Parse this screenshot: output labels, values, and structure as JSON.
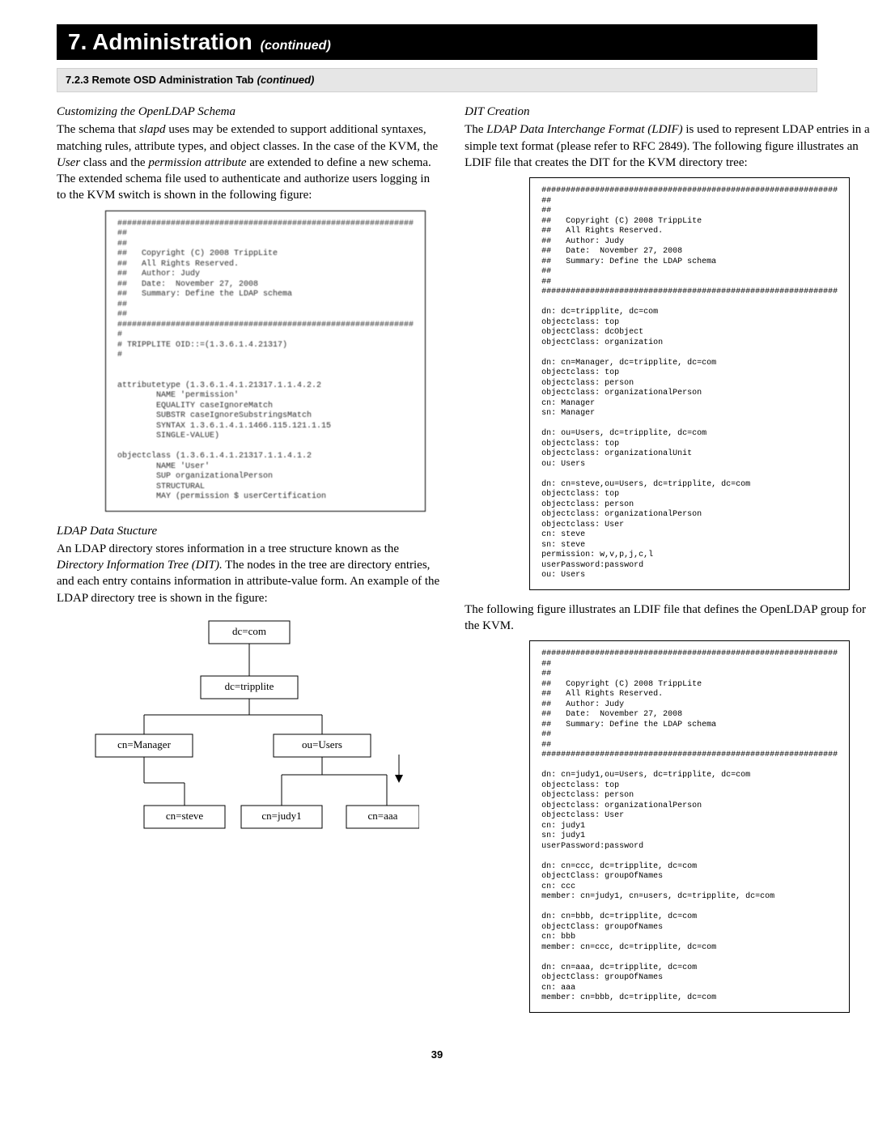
{
  "chapter": {
    "num": "7.",
    "title": "Administration",
    "continued": "(continued)"
  },
  "subhead": {
    "number": "7.2.3",
    "title": "Remote OSD Administration Tab",
    "continued": "(continued)"
  },
  "left": {
    "sec1_title": "Customizing the OpenLDAP Schema",
    "sec1_para": "The schema that slapd uses may be extended to support additional syntaxes, matching rules, attribute types, and object classes. In the case of the KVM, the User class and the permission attribute are extended to define a new schema. The extended schema file used to authenticate and authorize users logging in to the KVM switch is shown in the following figure:",
    "fig1": "#############################################################\n##\n##\n##   Copyright (C) 2008 TrippLite\n##   All Rights Reserved.\n##   Author: Judy\n##   Date:  November 27, 2008\n##   Summary: Define the LDAP schema\n##\n##\n#############################################################\n#\n# TRIPPLITE OID::=(1.3.6.1.4.21317)\n#\n\n\nattributetype (1.3.6.1.4.1.21317.1.1.4.2.2\n        NAME 'permission'\n        EQUALITY caseIgnoreMatch\n        SUBSTR caseIgnoreSubstringsMatch\n        SYNTAX 1.3.6.1.4.1.1466.115.121.1.15\n        SINGLE-VALUE)\n\nobjectclass (1.3.6.1.4.1.21317.1.1.4.1.2\n        NAME 'User'\n        SUP organizationalPerson\n        STRUCTURAL\n        MAY (permission $ userCertification",
    "sec2_title": "LDAP Data Stucture",
    "sec2_para": "An LDAP directory stores information in a tree structure known as the Directory Information Tree (DIT). The nodes in the tree are directory entries, and each entry contains information in attribute-value form. An example of the LDAP directory tree is shown in the figure:",
    "tree": {
      "root": "dc=com",
      "lvl2": "dc=tripplite",
      "lvl3a": "cn=Manager",
      "lvl3b": "ou=Users",
      "lvl4a": "cn=steve",
      "lvl4b": "cn=judy1",
      "lvl4c": "cn=aaa"
    }
  },
  "right": {
    "sec1_title": "DIT Creation",
    "sec1_para": "The LDAP Data Interchange Format (LDIF) is used to represent LDAP entries in a simple text format (please refer to RFC 2849). The following figure illustrates an LDIF file that creates the DIT for the KVM directory tree:",
    "fig1": "#############################################################\n##\n##\n##   Copyright (C) 2008 TrippLite\n##   All Rights Reserved.\n##   Author: Judy\n##   Date:  November 27, 2008\n##   Summary: Define the LDAP schema\n##\n##\n#############################################################\n\ndn: dc=tripplite, dc=com\nobjectclass: top\nobjectClass: dcObject\nobjectClass: organization\n\ndn: cn=Manager, dc=tripplite, dc=com\nobjectclass: top\nobjectclass: person\nobjectclass: organizationalPerson\ncn: Manager\nsn: Manager\n\ndn: ou=Users, dc=tripplite, dc=com\nobjectclass: top\nobjectclass: organizationalUnit\nou: Users\n\ndn: cn=steve,ou=Users, dc=tripplite, dc=com\nobjectclass: top\nobjectclass: person\nobjectclass: organizationalPerson\nobjectclass: User\ncn: steve\nsn: steve\npermission: w,v,p,j,c,l\nuserPassword:password\nou: Users",
    "sec2_para": "The following figure illustrates an LDIF file that defines the OpenLDAP group for the KVM.",
    "fig2": "#############################################################\n##\n##\n##   Copyright (C) 2008 TrippLite\n##   All Rights Reserved.\n##   Author: Judy\n##   Date:  November 27, 2008\n##   Summary: Define the LDAP schema\n##\n##\n#############################################################\n\ndn: cn=judy1,ou=Users, dc=tripplite, dc=com\nobjectclass: top\nobjectclass: person\nobjectclass: organizationalPerson\nobjectclass: User\ncn: judy1\nsn: judy1\nuserPassword:password\n\ndn: cn=ccc, dc=tripplite, dc=com\nobjectClass: groupOfNames\ncn: ccc\nmember: cn=judy1, cn=users, dc=tripplite, dc=com\n\ndn: cn=bbb, dc=tripplite, dc=com\nobjectClass: groupOfNames\ncn: bbb\nmember: cn=ccc, dc=tripplite, dc=com\n\ndn: cn=aaa, dc=tripplite, dc=com\nobjectClass: groupOfNames\ncn: aaa\nmember: cn=bbb, dc=tripplite, dc=com"
  },
  "page_num": "39"
}
